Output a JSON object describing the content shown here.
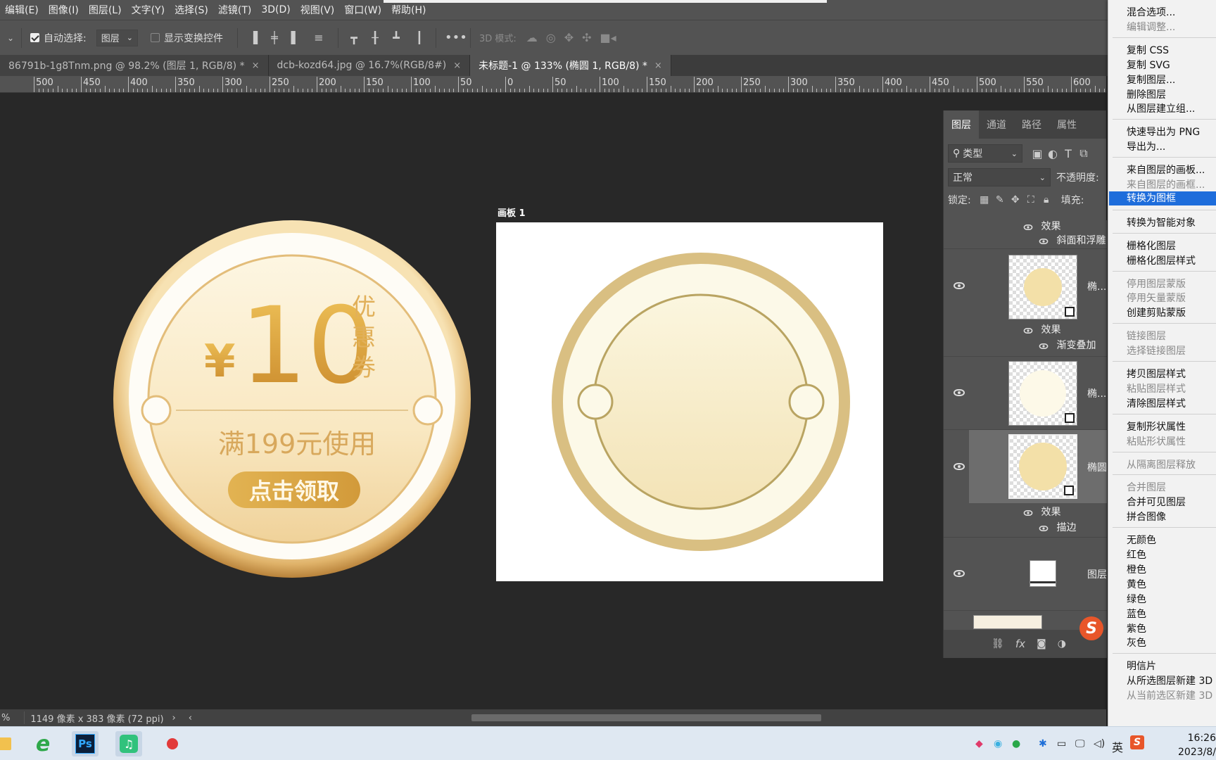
{
  "menubar": {
    "items": [
      "编辑(E)",
      "图像(I)",
      "图层(L)",
      "文字(Y)",
      "选择(S)",
      "滤镜(T)",
      "3D(D)",
      "视图(V)",
      "窗口(W)",
      "帮助(H)"
    ]
  },
  "options": {
    "auto_select_label": "自动选择:",
    "auto_select_target": "图层",
    "show_transform_label": "显示变换控件",
    "mode_3d_label": "3D 模式:"
  },
  "tabs": [
    {
      "label": "86791b-1g8Tnm.png @ 98.2% (图层 1, RGB/8) *",
      "close": "×"
    },
    {
      "label": "dcb-kozd64.jpg @ 16.7%(RGB/8#)",
      "close": "×"
    },
    {
      "label": "未标题-1 @ 133% (椭圆 1, RGB/8) *",
      "close": "×"
    }
  ],
  "ruler": {
    "labels": [
      "500",
      "450",
      "400",
      "350",
      "300",
      "250",
      "200",
      "150",
      "100",
      "50",
      "0",
      "50",
      "100",
      "150",
      "200",
      "250",
      "300",
      "350",
      "400",
      "450",
      "500",
      "550",
      "600"
    ]
  },
  "coupon": {
    "currency": "¥",
    "amount": "10",
    "side_text": [
      "优",
      "惠",
      "券"
    ],
    "condition": "满199元使用",
    "button": "点击领取"
  },
  "artboard": {
    "label": "画板 1"
  },
  "layers_panel": {
    "tabs": [
      "图层",
      "通道",
      "路径",
      "属性"
    ],
    "filter_kind": "类型",
    "blend_mode": "正常",
    "opacity_label": "不透明度:",
    "lock_label": "锁定:",
    "fill_label": "填充:",
    "rows": {
      "fx_top": "效果",
      "fx_top_item": "斜面和浮雕",
      "layer1_name": "椭...",
      "layer1_fx": "效果",
      "layer1_fx_item": "渐变叠加",
      "layer2_name": "椭...",
      "layer3_name": "椭圆",
      "layer3_fx": "效果",
      "layer3_fx_item": "描边",
      "layer4_name": "图层"
    },
    "footer_icons": [
      "link-icon",
      "fx-icon",
      "mask-icon",
      "adjustment-icon"
    ]
  },
  "context_menu": {
    "items": [
      {
        "label": "混合选项...",
        "disabled": false
      },
      {
        "label": "编辑调整...",
        "disabled": true
      },
      {
        "label": "复制 CSS",
        "disabled": false
      },
      {
        "label": "复制 SVG",
        "disabled": false
      },
      {
        "label": "复制图层...",
        "disabled": false
      },
      {
        "label": "删除图层",
        "disabled": false
      },
      {
        "label": "从图层建立组...",
        "disabled": false
      },
      {
        "label": "快速导出为 PNG",
        "disabled": false
      },
      {
        "label": "导出为...",
        "disabled": false
      },
      {
        "label": "来自图层的画板...",
        "disabled": false
      },
      {
        "label": "来自图层的画框...",
        "disabled": true
      },
      {
        "label": "转换为图框",
        "disabled": false,
        "selected": true
      },
      {
        "label": "转换为智能对象",
        "disabled": false
      },
      {
        "label": "栅格化图层",
        "disabled": false
      },
      {
        "label": "栅格化图层样式",
        "disabled": false
      },
      {
        "label": "停用图层蒙版",
        "disabled": true
      },
      {
        "label": "停用矢量蒙版",
        "disabled": true
      },
      {
        "label": "创建剪贴蒙版",
        "disabled": false
      },
      {
        "label": "链接图层",
        "disabled": true
      },
      {
        "label": "选择链接图层",
        "disabled": true
      },
      {
        "label": "拷贝图层样式",
        "disabled": false
      },
      {
        "label": "粘贴图层样式",
        "disabled": true
      },
      {
        "label": "清除图层样式",
        "disabled": false
      },
      {
        "label": "复制形状属性",
        "disabled": false
      },
      {
        "label": "粘贴形状属性",
        "disabled": true
      },
      {
        "label": "从隔离图层释放",
        "disabled": true
      },
      {
        "label": "合并图层",
        "disabled": true
      },
      {
        "label": "合并可见图层",
        "disabled": false
      },
      {
        "label": "拼合图像",
        "disabled": false
      },
      {
        "label": "无颜色",
        "disabled": false
      },
      {
        "label": "红色",
        "disabled": false
      },
      {
        "label": "橙色",
        "disabled": false
      },
      {
        "label": "黄色",
        "disabled": false
      },
      {
        "label": "绿色",
        "disabled": false
      },
      {
        "label": "蓝色",
        "disabled": false
      },
      {
        "label": "紫色",
        "disabled": false
      },
      {
        "label": "灰色",
        "disabled": false
      },
      {
        "label": "明信片",
        "disabled": false
      },
      {
        "label": "从所选图层新建 3D",
        "disabled": false
      },
      {
        "label": "从当前选区新建 3D",
        "disabled": true
      }
    ]
  },
  "status": {
    "zoom_suffix": "%",
    "doc_info": "1149 像素 x 383 像素 (72 ppi)"
  },
  "taskbar": {
    "apps": [
      "file-explorer-icon",
      "ie-browser-icon",
      "photoshop-icon",
      "music-app-icon",
      "recorder-icon"
    ],
    "ps_label": "Ps",
    "ime": "英",
    "time": "16:26",
    "date": "2023/8/"
  },
  "colors": {
    "accent_blue": "#1e6ddb",
    "gold": "#d9b86a",
    "cream": "#fbf7e4"
  }
}
